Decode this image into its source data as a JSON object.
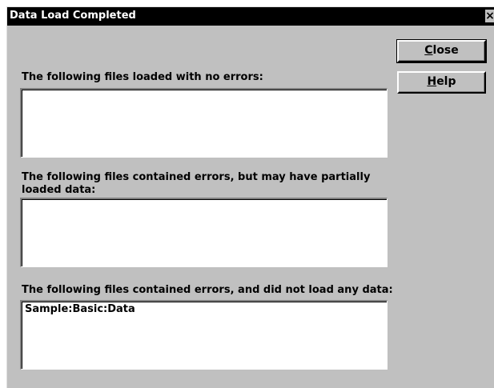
{
  "window": {
    "title": "Data Load Completed",
    "close_glyph": "×"
  },
  "buttons": {
    "close": {
      "mnemonic": "C",
      "rest": "lose"
    },
    "help": {
      "mnemonic": "H",
      "rest": "elp"
    }
  },
  "sections": {
    "no_errors": {
      "label": "The following files loaded with no errors:",
      "items": []
    },
    "partial_errors": {
      "label_line1": "The following files contained errors, but may have partially",
      "label_line2": "loaded data:",
      "items": []
    },
    "failed": {
      "label": "The following files contained errors, and did not load any data:",
      "items": [
        "Sample:Basic:Data"
      ]
    }
  }
}
